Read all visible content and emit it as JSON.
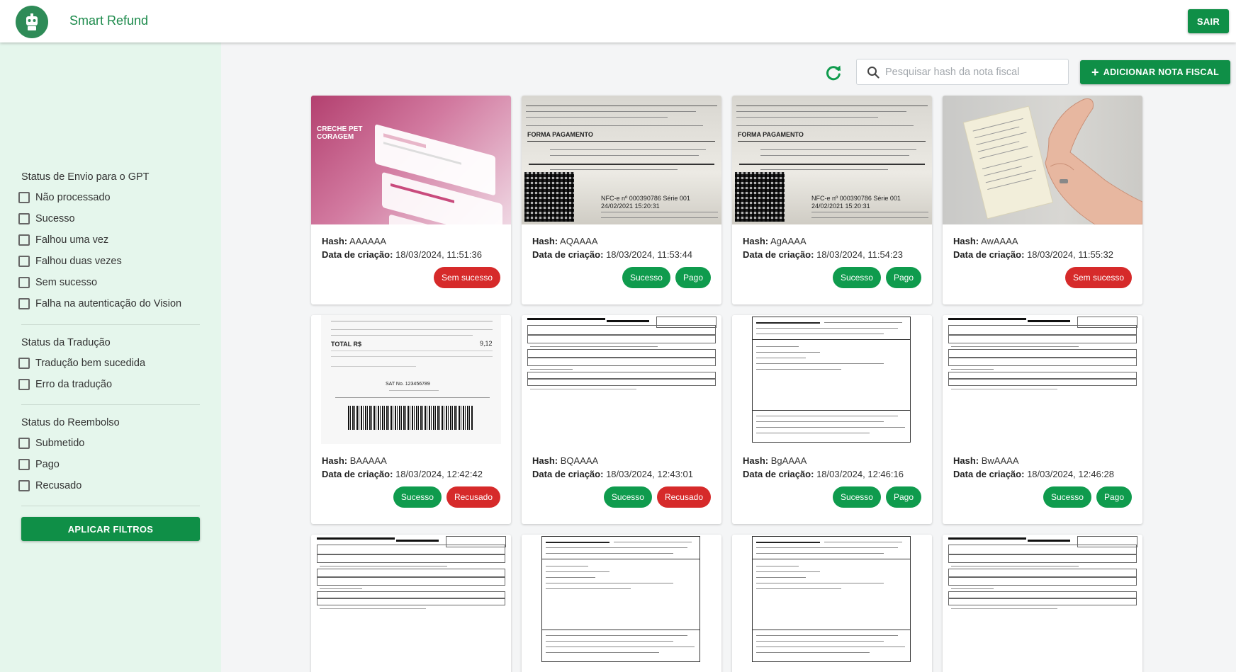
{
  "header": {
    "app_title": "Smart Refund",
    "logout_label": "SAIR"
  },
  "sidebar": {
    "groups": [
      {
        "title": "Status de Envio para o GPT",
        "options": [
          "Não processado",
          "Sucesso",
          "Falhou uma vez",
          "Falhou duas vezes",
          "Sem sucesso",
          "Falha na autenticação do Vision"
        ]
      },
      {
        "title": "Status da Tradução",
        "options": [
          "Tradução bem sucedida",
          "Erro da tradução"
        ]
      },
      {
        "title": "Status do Reembolso",
        "options": [
          "Submetido",
          "Pago",
          "Recusado"
        ]
      }
    ],
    "apply_label": "APLICAR FILTROS"
  },
  "toolbar": {
    "search_placeholder": "Pesquisar hash da nota fiscal",
    "add_label": "ADICIONAR NOTA FISCAL"
  },
  "labels": {
    "hash": "Hash:",
    "created": "Data de criação:"
  },
  "colors": {
    "primary_green": "#0f8f47",
    "sidebar_bg": "#e5f6ec",
    "badge_success": "#0f9b4d",
    "badge_error": "#d62a2a"
  },
  "cards": [
    {
      "hash": "AAAAAA",
      "date": "18/03/2024, 11:51:36",
      "badges": [
        "Sem sucesso"
      ],
      "thumb": "pink-ad",
      "thumb_text": [
        "CRECHE PET",
        "CORAGEM"
      ]
    },
    {
      "hash": "AQAAAA",
      "date": "18/03/2024, 11:53:44",
      "badges": [
        "Sucesso",
        "Pago"
      ],
      "thumb": "receipt-qr",
      "thumb_text": [
        "FORMA PAGAMENTO",
        "NFC-e nº 000390786 Série 001",
        "24/02/2021 15:20:31"
      ]
    },
    {
      "hash": "AgAAAA",
      "date": "18/03/2024, 11:54:23",
      "badges": [
        "Sucesso",
        "Pago"
      ],
      "thumb": "receipt-qr",
      "thumb_text": [
        "FORMA PAGAMENTO",
        "NFC-e nº 000390786 Série 001",
        "24/02/2021 15:20:31"
      ]
    },
    {
      "hash": "AwAAAA",
      "date": "18/03/2024, 11:55:32",
      "badges": [
        "Sem sucesso"
      ],
      "thumb": "hand-receipt",
      "thumb_text": []
    },
    {
      "hash": "BAAAAA",
      "date": "18/03/2024, 12:42:42",
      "badges": [
        "Sucesso",
        "Recusado"
      ],
      "thumb": "receipt-barcode",
      "thumb_text": [
        "TOTAL R$",
        "9,12",
        "SAT No. 123456789"
      ]
    },
    {
      "hash": "BQAAAA",
      "date": "18/03/2024, 12:43:01",
      "badges": [
        "Sucesso",
        "Recusado"
      ],
      "thumb": "invoice-form",
      "thumb_text": []
    },
    {
      "hash": "BgAAAA",
      "date": "18/03/2024, 12:46:16",
      "badges": [
        "Sucesso",
        "Pago"
      ],
      "thumb": "invoice-doc",
      "thumb_text": []
    },
    {
      "hash": "BwAAAA",
      "date": "18/03/2024, 12:46:28",
      "badges": [
        "Sucesso",
        "Pago"
      ],
      "thumb": "invoice-form",
      "thumb_text": []
    },
    {
      "hash": "",
      "date": "",
      "badges": [],
      "thumb": "invoice-form",
      "thumb_text": []
    },
    {
      "hash": "",
      "date": "",
      "badges": [],
      "thumb": "invoice-doc",
      "thumb_text": []
    },
    {
      "hash": "",
      "date": "",
      "badges": [],
      "thumb": "invoice-doc",
      "thumb_text": []
    },
    {
      "hash": "",
      "date": "",
      "badges": [],
      "thumb": "invoice-form",
      "thumb_text": []
    }
  ]
}
